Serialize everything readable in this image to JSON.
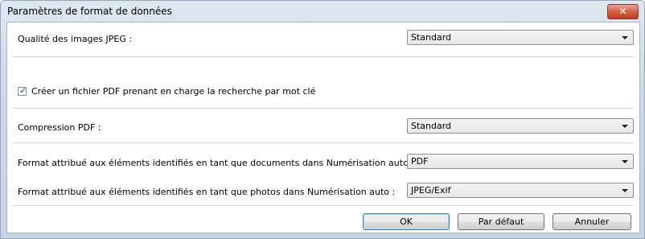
{
  "window": {
    "title": "Paramètres de format de données",
    "close_icon": "close-x-icon"
  },
  "jpeg_quality": {
    "label": "Qualité des images JPEG :",
    "value": "Standard"
  },
  "pdf_search": {
    "label": "Créer un fichier PDF prenant en charge la recherche par mot clé",
    "checked": true
  },
  "pdf_compression": {
    "label": "Compression PDF :",
    "value": "Standard"
  },
  "auto_doc_format": {
    "label": "Format attribué aux éléments identifiés en tant que documents dans Numérisation auto :",
    "value": "PDF"
  },
  "auto_photo_format": {
    "label": "Format attribué aux éléments identifiés en tant que photos dans Numérisation auto :",
    "value": "JPEG/Exif"
  },
  "buttons": {
    "ok": "OK",
    "default": "Par défaut",
    "cancel": "Annuler"
  }
}
